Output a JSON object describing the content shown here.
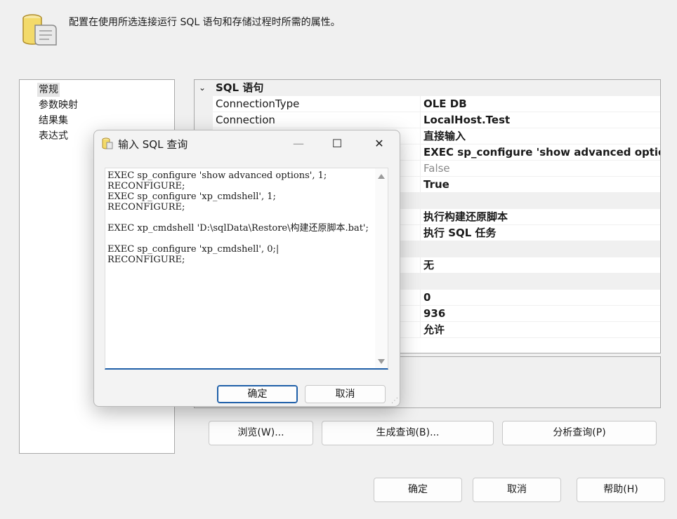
{
  "header": {
    "description": "配置在使用所选连接运行 SQL 语句和存储过程时所需的属性。",
    "icon": "scroll-db-icon"
  },
  "nav": {
    "items": [
      {
        "label": "常规",
        "selected": true
      },
      {
        "label": "参数映射",
        "selected": false
      },
      {
        "label": "结果集",
        "selected": false
      },
      {
        "label": "表达式",
        "selected": false
      }
    ]
  },
  "grid": {
    "category_sql": "SQL 语句",
    "rows": [
      {
        "name": "ConnectionType",
        "value": "OLE DB"
      },
      {
        "name": "Connection",
        "value": "LocalHost.Test"
      },
      {
        "name": "",
        "value": "直接输入"
      },
      {
        "name": "",
        "value": "EXEC sp_configure 'show advanced options',"
      },
      {
        "name": "",
        "value": "False"
      },
      {
        "name": "",
        "value": "True"
      },
      {
        "name": "",
        "value": "执行构建还原脚本"
      },
      {
        "name": "",
        "value": "执行 SQL 任务"
      },
      {
        "name": "",
        "value": "无"
      },
      {
        "name": "",
        "value": "0"
      },
      {
        "name": "",
        "value": "936"
      },
      {
        "name": "",
        "value": "允许"
      }
    ]
  },
  "buttons": {
    "browse": "浏览(W)...",
    "build_query": "生成查询(B)...",
    "parse_query": "分析查询(P)",
    "ok": "确定",
    "cancel": "取消",
    "help": "帮助(H)"
  },
  "dialog": {
    "title": "输入 SQL 查询",
    "code": "EXEC sp_configure 'show advanced options', 1;\nRECONFIGURE;\nEXEC sp_configure 'xp_cmdshell', 1;\nRECONFIGURE;\n\nEXEC xp_cmdshell 'D:\\sqlData\\Restore\\构建还原脚本.bat';\n\nEXEC sp_configure 'xp_cmdshell', 0;|\nRECONFIGURE;",
    "ok": "确定",
    "cancel": "取消",
    "minimize": "—",
    "maximize": "☐",
    "close": "✕"
  },
  "colors": {
    "accent": "#1f5fa8",
    "background": "#f0f0f0"
  }
}
